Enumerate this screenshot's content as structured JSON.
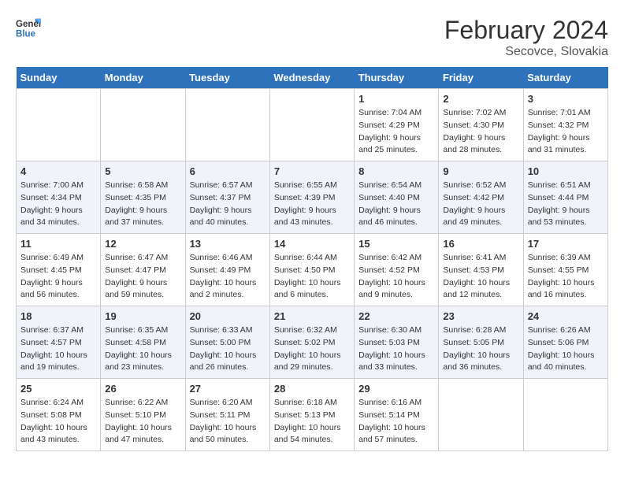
{
  "header": {
    "logo_line1": "General",
    "logo_line2": "Blue",
    "month_title": "February 2024",
    "subtitle": "Secovce, Slovakia"
  },
  "days_of_week": [
    "Sunday",
    "Monday",
    "Tuesday",
    "Wednesday",
    "Thursday",
    "Friday",
    "Saturday"
  ],
  "weeks": [
    [
      {
        "day": "",
        "info": ""
      },
      {
        "day": "",
        "info": ""
      },
      {
        "day": "",
        "info": ""
      },
      {
        "day": "",
        "info": ""
      },
      {
        "day": "1",
        "info": "Sunrise: 7:04 AM\nSunset: 4:29 PM\nDaylight: 9 hours\nand 25 minutes."
      },
      {
        "day": "2",
        "info": "Sunrise: 7:02 AM\nSunset: 4:30 PM\nDaylight: 9 hours\nand 28 minutes."
      },
      {
        "day": "3",
        "info": "Sunrise: 7:01 AM\nSunset: 4:32 PM\nDaylight: 9 hours\nand 31 minutes."
      }
    ],
    [
      {
        "day": "4",
        "info": "Sunrise: 7:00 AM\nSunset: 4:34 PM\nDaylight: 9 hours\nand 34 minutes."
      },
      {
        "day": "5",
        "info": "Sunrise: 6:58 AM\nSunset: 4:35 PM\nDaylight: 9 hours\nand 37 minutes."
      },
      {
        "day": "6",
        "info": "Sunrise: 6:57 AM\nSunset: 4:37 PM\nDaylight: 9 hours\nand 40 minutes."
      },
      {
        "day": "7",
        "info": "Sunrise: 6:55 AM\nSunset: 4:39 PM\nDaylight: 9 hours\nand 43 minutes."
      },
      {
        "day": "8",
        "info": "Sunrise: 6:54 AM\nSunset: 4:40 PM\nDaylight: 9 hours\nand 46 minutes."
      },
      {
        "day": "9",
        "info": "Sunrise: 6:52 AM\nSunset: 4:42 PM\nDaylight: 9 hours\nand 49 minutes."
      },
      {
        "day": "10",
        "info": "Sunrise: 6:51 AM\nSunset: 4:44 PM\nDaylight: 9 hours\nand 53 minutes."
      }
    ],
    [
      {
        "day": "11",
        "info": "Sunrise: 6:49 AM\nSunset: 4:45 PM\nDaylight: 9 hours\nand 56 minutes."
      },
      {
        "day": "12",
        "info": "Sunrise: 6:47 AM\nSunset: 4:47 PM\nDaylight: 9 hours\nand 59 minutes."
      },
      {
        "day": "13",
        "info": "Sunrise: 6:46 AM\nSunset: 4:49 PM\nDaylight: 10 hours\nand 2 minutes."
      },
      {
        "day": "14",
        "info": "Sunrise: 6:44 AM\nSunset: 4:50 PM\nDaylight: 10 hours\nand 6 minutes."
      },
      {
        "day": "15",
        "info": "Sunrise: 6:42 AM\nSunset: 4:52 PM\nDaylight: 10 hours\nand 9 minutes."
      },
      {
        "day": "16",
        "info": "Sunrise: 6:41 AM\nSunset: 4:53 PM\nDaylight: 10 hours\nand 12 minutes."
      },
      {
        "day": "17",
        "info": "Sunrise: 6:39 AM\nSunset: 4:55 PM\nDaylight: 10 hours\nand 16 minutes."
      }
    ],
    [
      {
        "day": "18",
        "info": "Sunrise: 6:37 AM\nSunset: 4:57 PM\nDaylight: 10 hours\nand 19 minutes."
      },
      {
        "day": "19",
        "info": "Sunrise: 6:35 AM\nSunset: 4:58 PM\nDaylight: 10 hours\nand 23 minutes."
      },
      {
        "day": "20",
        "info": "Sunrise: 6:33 AM\nSunset: 5:00 PM\nDaylight: 10 hours\nand 26 minutes."
      },
      {
        "day": "21",
        "info": "Sunrise: 6:32 AM\nSunset: 5:02 PM\nDaylight: 10 hours\nand 29 minutes."
      },
      {
        "day": "22",
        "info": "Sunrise: 6:30 AM\nSunset: 5:03 PM\nDaylight: 10 hours\nand 33 minutes."
      },
      {
        "day": "23",
        "info": "Sunrise: 6:28 AM\nSunset: 5:05 PM\nDaylight: 10 hours\nand 36 minutes."
      },
      {
        "day": "24",
        "info": "Sunrise: 6:26 AM\nSunset: 5:06 PM\nDaylight: 10 hours\nand 40 minutes."
      }
    ],
    [
      {
        "day": "25",
        "info": "Sunrise: 6:24 AM\nSunset: 5:08 PM\nDaylight: 10 hours\nand 43 minutes."
      },
      {
        "day": "26",
        "info": "Sunrise: 6:22 AM\nSunset: 5:10 PM\nDaylight: 10 hours\nand 47 minutes."
      },
      {
        "day": "27",
        "info": "Sunrise: 6:20 AM\nSunset: 5:11 PM\nDaylight: 10 hours\nand 50 minutes."
      },
      {
        "day": "28",
        "info": "Sunrise: 6:18 AM\nSunset: 5:13 PM\nDaylight: 10 hours\nand 54 minutes."
      },
      {
        "day": "29",
        "info": "Sunrise: 6:16 AM\nSunset: 5:14 PM\nDaylight: 10 hours\nand 57 minutes."
      },
      {
        "day": "",
        "info": ""
      },
      {
        "day": "",
        "info": ""
      }
    ]
  ]
}
